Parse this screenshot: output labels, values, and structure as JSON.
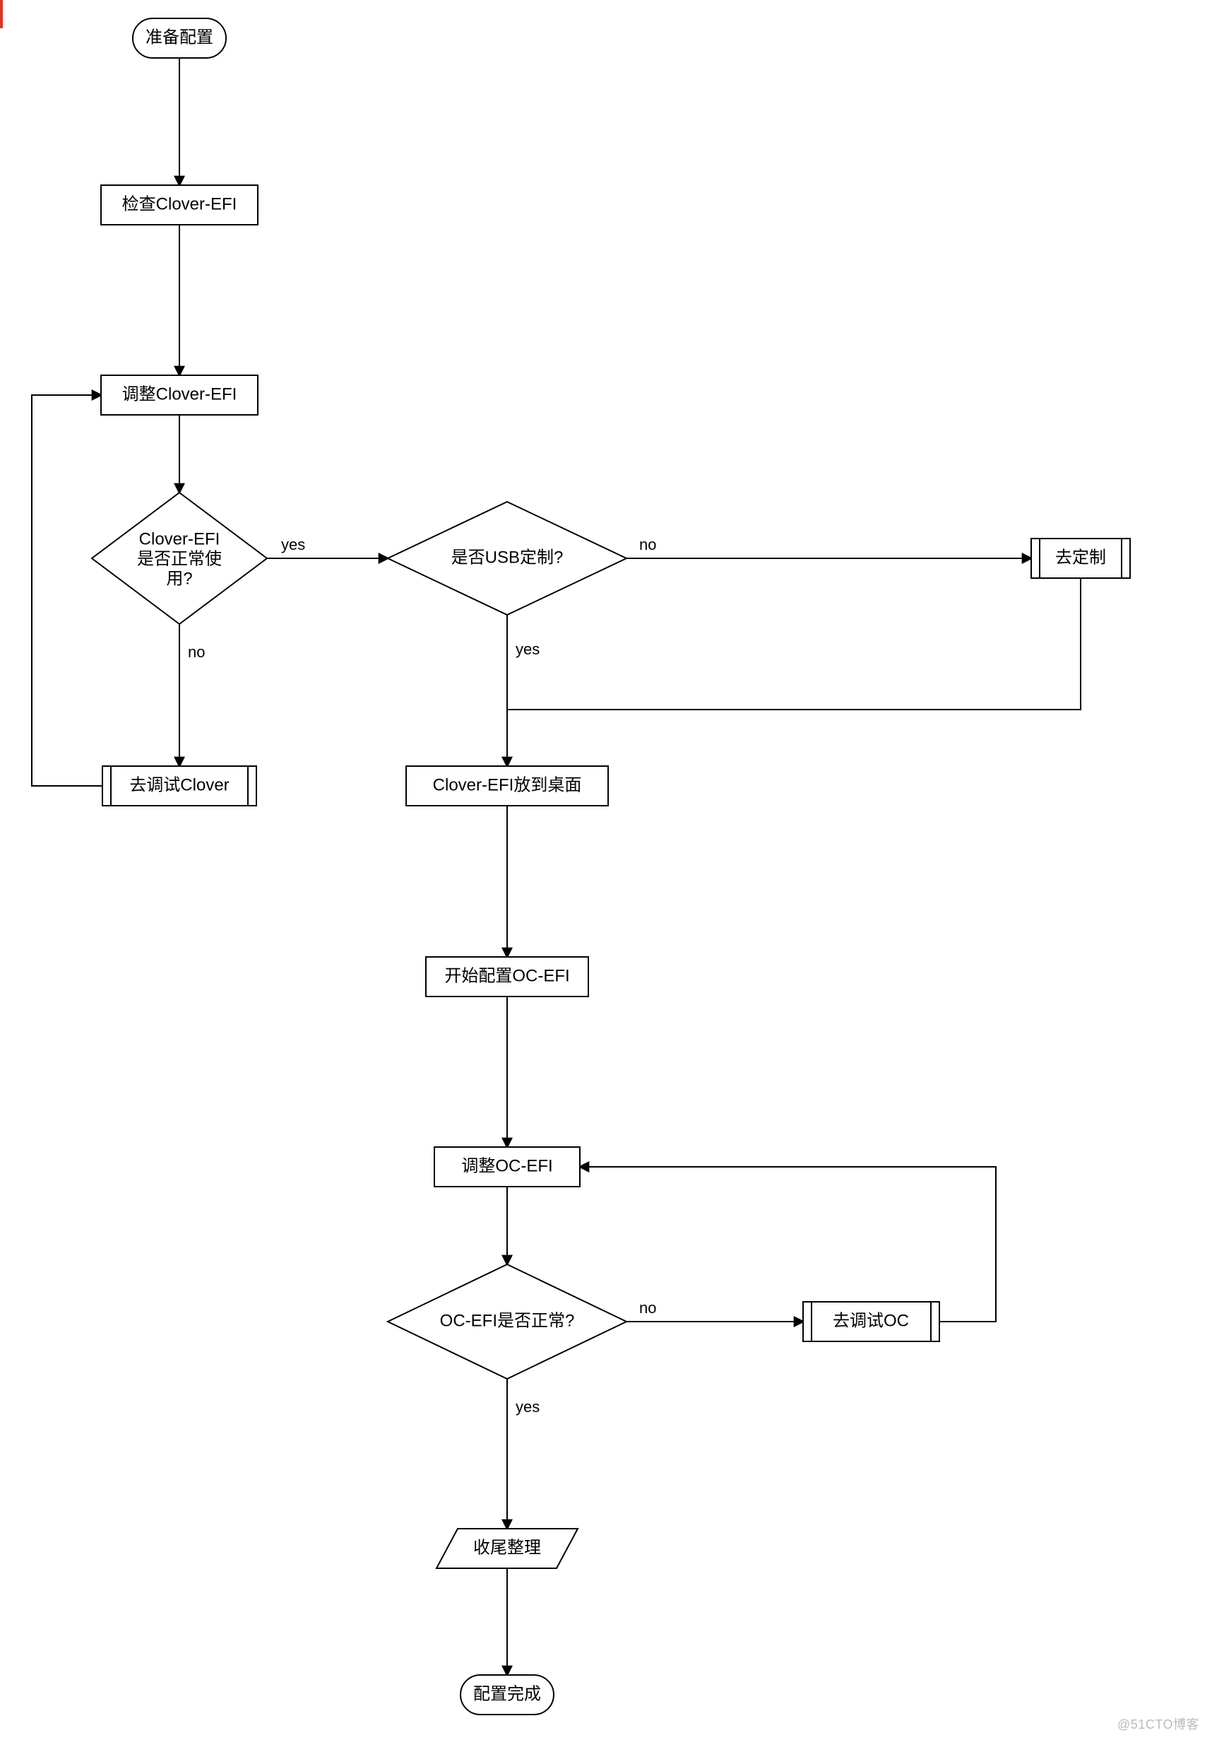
{
  "flowchart": {
    "nodes": {
      "start": {
        "type": "terminator",
        "label": "准备配置"
      },
      "checkClover": {
        "type": "process",
        "label": "检查Clover-EFI"
      },
      "adjustClover": {
        "type": "process",
        "label": "调整Clover-EFI"
      },
      "cloverOk": {
        "type": "decision",
        "label_l1": "Clover-EFI",
        "label_l2": "是否正常使",
        "label_l3": "用?"
      },
      "usbCustom": {
        "type": "decision",
        "label": "是否USB定制?"
      },
      "goCustom": {
        "type": "subroutine",
        "label": "去定制"
      },
      "debugClover": {
        "type": "subroutine",
        "label": "去调试Clover"
      },
      "efiDesktop": {
        "type": "process",
        "label": "Clover-EFI放到桌面"
      },
      "startOC": {
        "type": "process",
        "label": "开始配置OC-EFI"
      },
      "adjustOC": {
        "type": "process",
        "label": "调整OC-EFI"
      },
      "ocOk": {
        "type": "decision",
        "label": "OC-EFI是否正常?"
      },
      "debugOC": {
        "type": "subroutine",
        "label": "去调试OC"
      },
      "cleanup": {
        "type": "data",
        "label": "收尾整理"
      },
      "end": {
        "type": "terminator",
        "label": "配置完成"
      }
    },
    "edges": {
      "cloverOk_yes": "yes",
      "cloverOk_no": "no",
      "usb_yes": "yes",
      "usb_no": "no",
      "ocOk_yes": "yes",
      "ocOk_no": "no"
    }
  },
  "watermark": "@51CTO博客"
}
